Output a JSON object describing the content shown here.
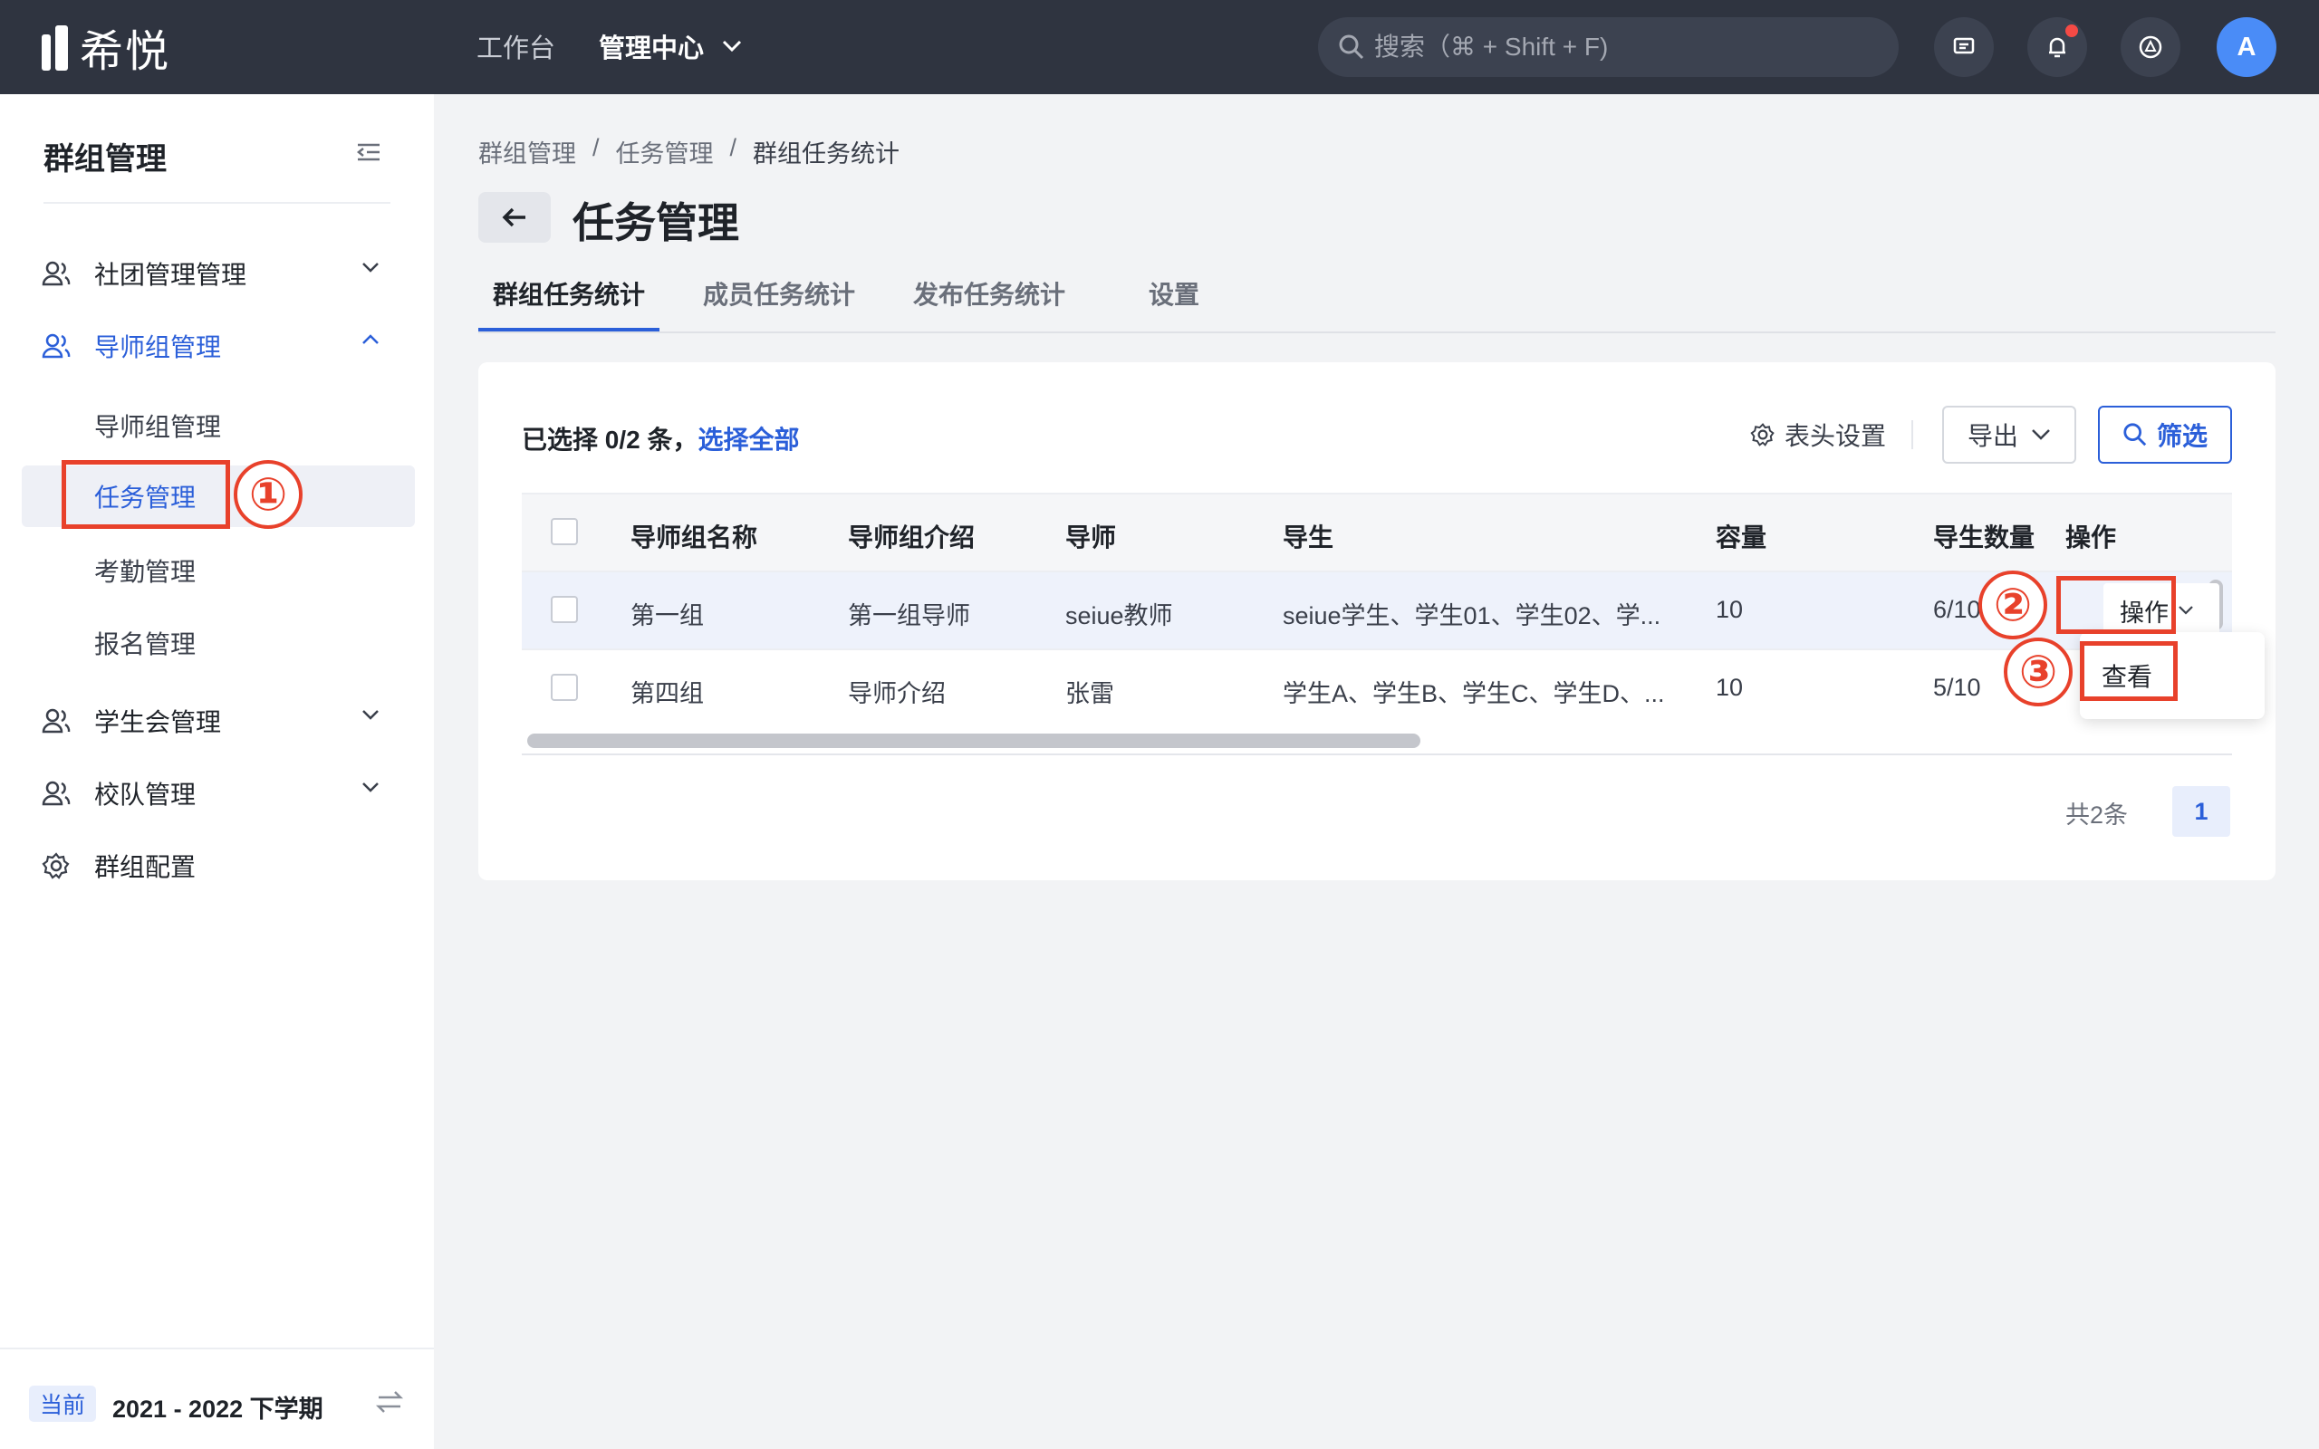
{
  "app": {
    "logo_text": "希悦"
  },
  "topnav": {
    "workbench": "工作台",
    "management": "管理中心"
  },
  "search": {
    "placeholder": "搜索（⌘ + Shift + F)"
  },
  "user": {
    "avatar_letter": "A"
  },
  "sidebar": {
    "title": "群组管理",
    "items": [
      {
        "label": "社团管理管理"
      },
      {
        "label": "导师组管理"
      },
      {
        "label": "学生会管理"
      },
      {
        "label": "校队管理"
      },
      {
        "label": "群组配置"
      }
    ],
    "subitems": [
      {
        "label": "导师组管理"
      },
      {
        "label": "任务管理"
      },
      {
        "label": "考勤管理"
      },
      {
        "label": "报名管理"
      }
    ],
    "term_tag": "当前",
    "term": "2021 - 2022 下学期"
  },
  "breadcrumb": {
    "level1": "群组管理",
    "level2": "任务管理",
    "level3": "群组任务统计",
    "sep": "/"
  },
  "page": {
    "title": "任务管理"
  },
  "tabs": [
    {
      "label": "群组任务统计"
    },
    {
      "label": "成员任务统计"
    },
    {
      "label": "发布任务统计"
    },
    {
      "label": "设置"
    }
  ],
  "toolbar": {
    "selected_info": "已选择 0/2 条，",
    "select_all": "选择全部",
    "column_settings": "表头设置",
    "export": "导出",
    "filter": "筛选"
  },
  "table": {
    "headers": [
      "导师组名称",
      "导师组介绍",
      "导师",
      "导生",
      "容量",
      "导生数量",
      "操作"
    ],
    "rows": [
      {
        "name": "第一组",
        "intro": "第一组导师",
        "mentor": "seiue教师",
        "students": "seiue学生、学生01、学生02、学...",
        "capacity": "10",
        "count": "6/10",
        "action": "操作"
      },
      {
        "name": "第四组",
        "intro": "导师介绍",
        "mentor": "张雷",
        "students": "学生A、学生B、学生C、学生D、...",
        "capacity": "10",
        "count": "5/10",
        "action": ""
      }
    ]
  },
  "dropdown": {
    "view": "查看"
  },
  "pagination": {
    "total": "共2条",
    "current": "1"
  },
  "annotations": {
    "step1": "①",
    "step2": "②",
    "step3": "③"
  },
  "colors": {
    "primary": "#2b5fd9",
    "topbar": "#2f3440",
    "highlight": "#e8412b",
    "notification": "#f54a45"
  }
}
